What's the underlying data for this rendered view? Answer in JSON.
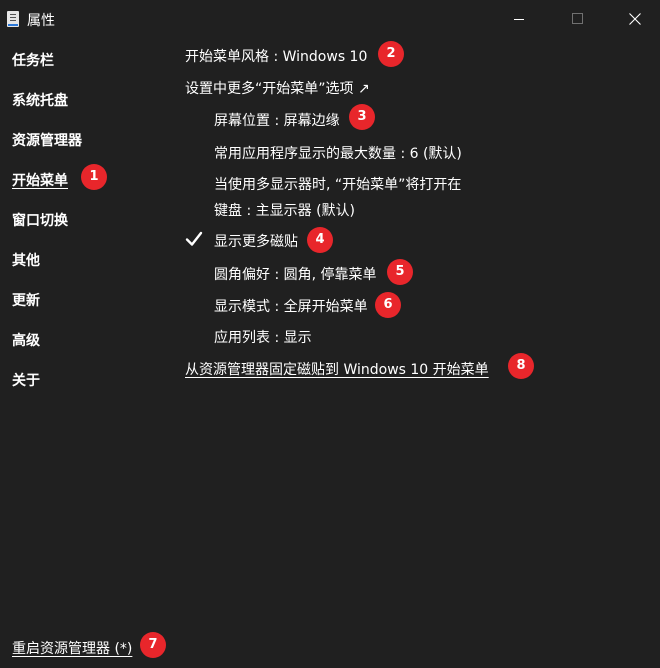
{
  "window": {
    "title": "属性"
  },
  "sidebar": {
    "items": [
      {
        "label": "任务栏"
      },
      {
        "label": "系统托盘"
      },
      {
        "label": "资源管理器"
      },
      {
        "label": "开始菜单"
      },
      {
        "label": "窗口切换"
      },
      {
        "label": "其他"
      },
      {
        "label": "更新"
      },
      {
        "label": "高级"
      },
      {
        "label": "关于"
      }
    ],
    "active": "开始菜单",
    "restart_label": "重启资源管理器 (*)"
  },
  "main": {
    "start_style": "开始菜单风格 : Windows 10",
    "more_options": "设置中更多“开始菜单”选项 ↗",
    "screen_position": "屏幕位置 : 屏幕边缘",
    "max_frequent_apps": "常用应用程序显示的最大数量 : 6 (默认)",
    "multi_monitor_line1": "当使用多显示器时, “开始菜单”将打开在",
    "multi_monitor_line2": "键盘 : 主显示器 (默认)",
    "show_more_tiles": "显示更多磁贴",
    "show_more_tiles_checked": true,
    "corner_pref": "圆角偏好 : 圆角, 停靠菜单",
    "display_mode": "显示模式 : 全屏开始菜单",
    "app_list": "应用列表 : 显示",
    "pin_tiles": "从资源管理器固定磁贴到 Windows 10 开始菜单"
  },
  "badges": [
    "1",
    "2",
    "3",
    "4",
    "5",
    "6",
    "7",
    "8"
  ],
  "colors": {
    "background": "#202020",
    "text": "#ffffff",
    "badge": "#e8262b"
  },
  "icons": [
    "app-icon",
    "minimize-icon",
    "maximize-icon",
    "close-icon",
    "checkmark-icon"
  ]
}
